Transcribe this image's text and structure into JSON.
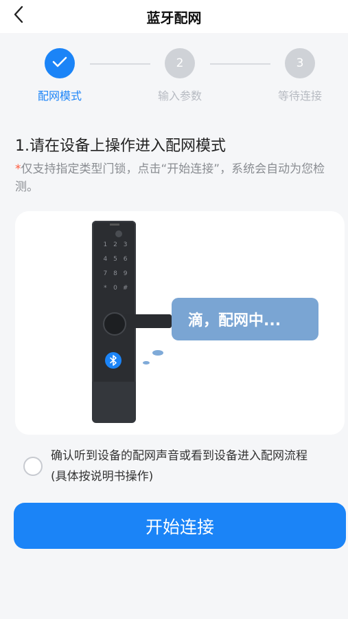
{
  "header": {
    "title": "蓝牙配网",
    "back_icon": "chevron-left-icon"
  },
  "stepper": {
    "steps": [
      {
        "label": "配网模式",
        "number": "",
        "state": "done",
        "icon": "check-icon"
      },
      {
        "label": "输入参数",
        "number": "2",
        "state": "pending"
      },
      {
        "label": "等待连接",
        "number": "3",
        "state": "pending"
      }
    ],
    "active_color": "#1b84f7",
    "inactive_color": "#cfd2d7"
  },
  "instructions": {
    "title": "1.请在设备上操作进入配网模式",
    "note_star": "*",
    "note": "仅支持指定类型门锁，点击“开始连接”，系统会自动为您检测。"
  },
  "illustration": {
    "bubble_text": "滴，配网中...",
    "keypad_keys": [
      "1",
      "2",
      "3",
      "4",
      "5",
      "6",
      "7",
      "8",
      "9",
      "*",
      "0",
      "#"
    ],
    "bluetooth_icon": "bluetooth-icon"
  },
  "confirm": {
    "text": "确认听到设备的配网声音或看到设备进入配网流程  (具体按说明书操作)",
    "checked": false
  },
  "actions": {
    "start_label": "开始连接"
  }
}
